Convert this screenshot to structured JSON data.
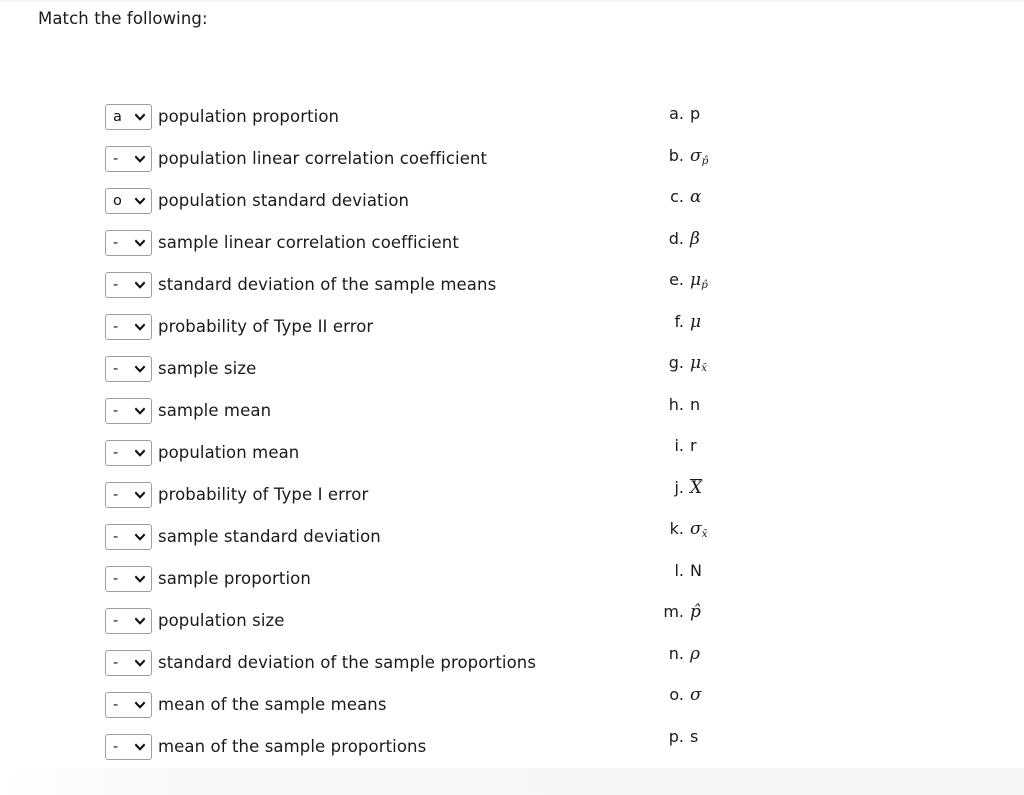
{
  "page": {
    "title": "Match the following:"
  },
  "select": {
    "placeholder_value": "-",
    "chevron_icon": "chevron-down-icon"
  },
  "prompts": [
    {
      "value": "a",
      "label": "population proportion"
    },
    {
      "value": "-",
      "label": "population linear correlation coefficient"
    },
    {
      "value": "o",
      "label": "population standard deviation"
    },
    {
      "value": "-",
      "label": "sample linear correlation coefficient"
    },
    {
      "value": "-",
      "label": "standard deviation of the sample means"
    },
    {
      "value": "-",
      "label": "probability of Type II error"
    },
    {
      "value": "-",
      "label": "sample size"
    },
    {
      "value": "-",
      "label": "sample mean"
    },
    {
      "value": "-",
      "label": "population mean"
    },
    {
      "value": "-",
      "label": "probability of Type I error"
    },
    {
      "value": "-",
      "label": "sample standard deviation"
    },
    {
      "value": "-",
      "label": "sample proportion"
    },
    {
      "value": "-",
      "label": "population size"
    },
    {
      "value": "-",
      "label": "standard deviation of the sample proportions"
    },
    {
      "value": "-",
      "label": "mean of the sample means"
    },
    {
      "value": "-",
      "label": "mean of the sample proportions"
    }
  ],
  "options": [
    {
      "letter": "a.",
      "symbol": "p",
      "style": "roman"
    },
    {
      "letter": "b.",
      "symbol": "σ",
      "sub": "p̂",
      "style": "greek"
    },
    {
      "letter": "c.",
      "symbol": "α",
      "style": "greek"
    },
    {
      "letter": "d.",
      "symbol": "β",
      "style": "greek"
    },
    {
      "letter": "e.",
      "symbol": "μ",
      "sub": "p̂",
      "style": "greek"
    },
    {
      "letter": "f.",
      "symbol": "μ",
      "style": "greek"
    },
    {
      "letter": "g.",
      "symbol": "μ",
      "sub": "x̄",
      "style": "greek"
    },
    {
      "letter": "h.",
      "symbol": "n",
      "style": "roman"
    },
    {
      "letter": "i.",
      "symbol": "r",
      "style": "roman"
    },
    {
      "letter": "j.",
      "symbol": "X",
      "overline": true,
      "style": "math"
    },
    {
      "letter": "k.",
      "symbol": "σ",
      "sub": "x̄",
      "style": "greek"
    },
    {
      "letter": "l.",
      "symbol": "N",
      "style": "roman"
    },
    {
      "letter": "m.",
      "symbol": "p̂",
      "style": "math"
    },
    {
      "letter": "n.",
      "symbol": "ρ",
      "style": "greek"
    },
    {
      "letter": "o.",
      "symbol": "σ",
      "style": "greek"
    },
    {
      "letter": "p.",
      "symbol": "s",
      "style": "roman"
    }
  ],
  "colors": {
    "text": "#1a1a1a",
    "select_border": "#9e9e9e",
    "background": "#ffffff",
    "bottom_band": "#f6f6f6"
  }
}
